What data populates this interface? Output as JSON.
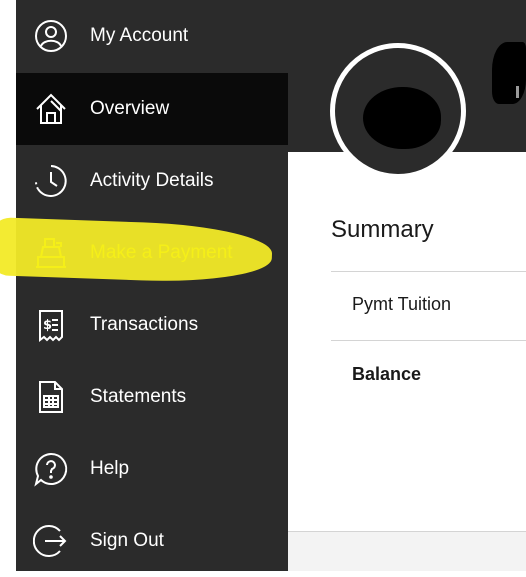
{
  "sidebar": {
    "items": [
      {
        "label": "My Account",
        "icon": "user-circle-icon"
      },
      {
        "label": "Overview",
        "icon": "home-icon"
      },
      {
        "label": "Activity Details",
        "icon": "clock-icon"
      },
      {
        "label": "Make a Payment",
        "icon": "cash-register-icon"
      },
      {
        "label": "Transactions",
        "icon": "receipt-icon"
      },
      {
        "label": "Statements",
        "icon": "statement-document-icon"
      },
      {
        "label": "Help",
        "icon": "help-bubble-icon"
      },
      {
        "label": "Sign Out",
        "icon": "sign-out-icon"
      }
    ],
    "active": "Overview"
  },
  "summary": {
    "title": "Summary",
    "rows": [
      {
        "label": "Pymt Tuition"
      },
      {
        "label": "Balance"
      }
    ]
  },
  "colors": {
    "sidebar_bg": "#2b2b2b",
    "active_bg": "#0a0a0a",
    "highlight": "#f2ea27"
  }
}
